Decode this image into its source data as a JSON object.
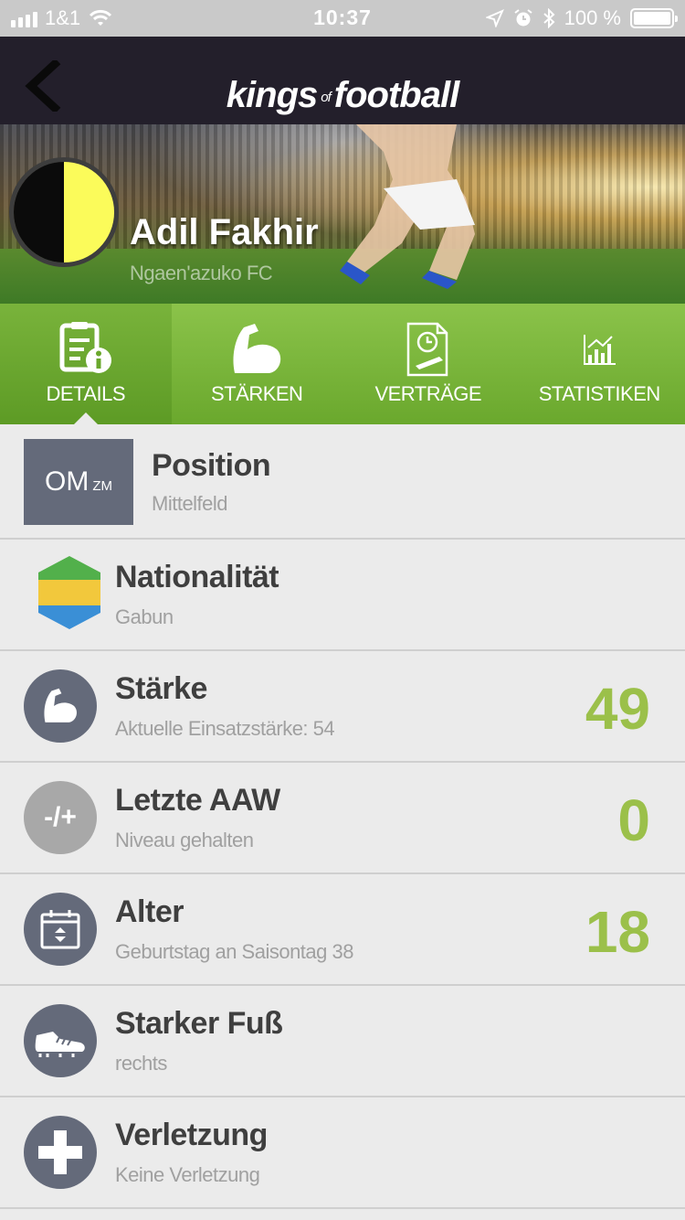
{
  "status_bar": {
    "carrier": "1&1",
    "time": "10:37",
    "battery_percent": "100 %"
  },
  "navbar": {
    "logo_main": "kings",
    "logo_of": "of",
    "logo_end": "football"
  },
  "player": {
    "name": "Adil Fakhir",
    "club": "Ngaen'azuko FC",
    "club_colors": {
      "left": "#0b0b0b",
      "right": "#fbfb5a"
    }
  },
  "tabs": [
    {
      "label": "DETAILS",
      "icon": "details-icon",
      "active": true
    },
    {
      "label": "STÄRKEN",
      "icon": "strength-arm-icon",
      "active": false
    },
    {
      "label": "VERTRÄGE",
      "icon": "contract-icon",
      "active": false
    },
    {
      "label": "STATISTIKEN",
      "icon": "statistics-icon",
      "active": false
    }
  ],
  "details": {
    "position": {
      "primary": "OM",
      "secondary": "ZM",
      "title": "Position",
      "subtitle": "Mittelfeld"
    },
    "nationality": {
      "title": "Nationalität",
      "subtitle": "Gabun",
      "flag_colors": [
        "#52b04b",
        "#f2c83c",
        "#3a8fd6"
      ]
    },
    "strength": {
      "title": "Stärke",
      "subtitle": "Aktuelle Einsatzstärke: 54",
      "value": "49"
    },
    "last_aaw": {
      "title": "Letzte AAW",
      "subtitle": "Niveau gehalten",
      "value": "0",
      "icon_label": "-/+"
    },
    "age": {
      "title": "Alter",
      "subtitle": "Geburtstag an Saisontag 38",
      "value": "18"
    },
    "strong_foot": {
      "title": "Starker Fuß",
      "subtitle": "rechts"
    },
    "injury": {
      "title": "Verletzung",
      "subtitle": "Keine Verletzung"
    }
  },
  "colors": {
    "accent_green": "#9bc04a",
    "navbar_dark": "#231f2b",
    "icon_circle": "#646a7a"
  }
}
